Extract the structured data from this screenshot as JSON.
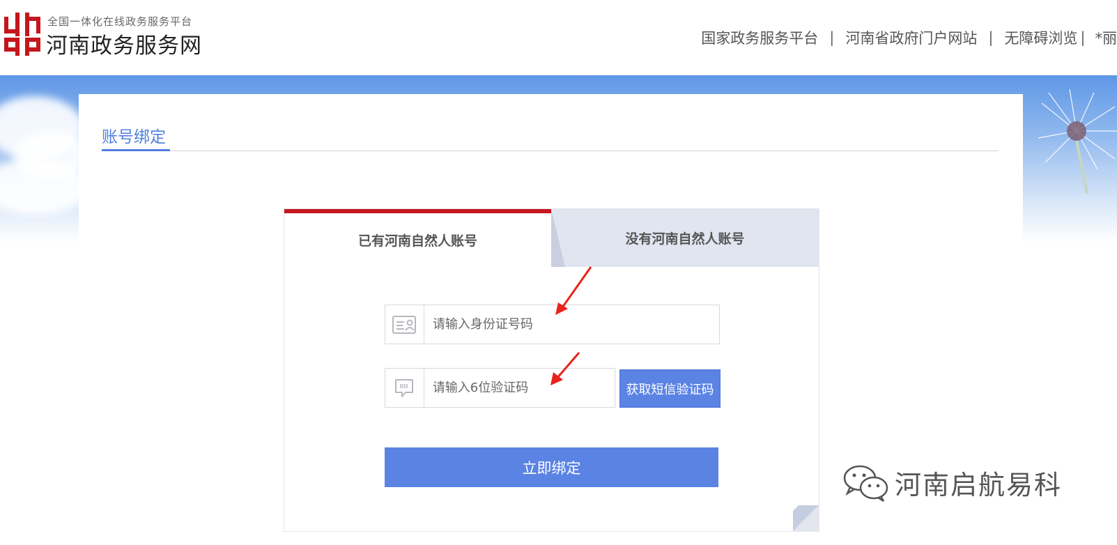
{
  "header": {
    "logo_subtitle": "全国一体化在线政务服务平台",
    "logo_title": "河南政务服务网",
    "nav": [
      {
        "label": "国家政务服务平台"
      },
      {
        "label": "河南省政府门户网站"
      },
      {
        "label": "无障碍浏览"
      },
      {
        "label": "*丽"
      }
    ],
    "separator": "|"
  },
  "page": {
    "section_title": "账号绑定"
  },
  "card": {
    "tabs": [
      {
        "label": "已有河南自然人账号",
        "active": true
      },
      {
        "label": "没有河南自然人账号",
        "active": false
      }
    ],
    "id_input": {
      "placeholder": "请输入身份证号码",
      "value": "",
      "icon": "id-card-icon"
    },
    "code_input": {
      "placeholder": "请输入6位验证码",
      "value": "",
      "icon": "message-icon"
    },
    "sms_button": "获取短信验证码",
    "submit_button": "立即绑定"
  },
  "watermark": {
    "text": "河南启航易科",
    "icon": "wechat-icon"
  },
  "colors": {
    "accent": "#5b83e4",
    "tab_active_border": "#c4161c",
    "section_title": "#4f7fe0",
    "annotation_arrow": "#e8231c"
  }
}
